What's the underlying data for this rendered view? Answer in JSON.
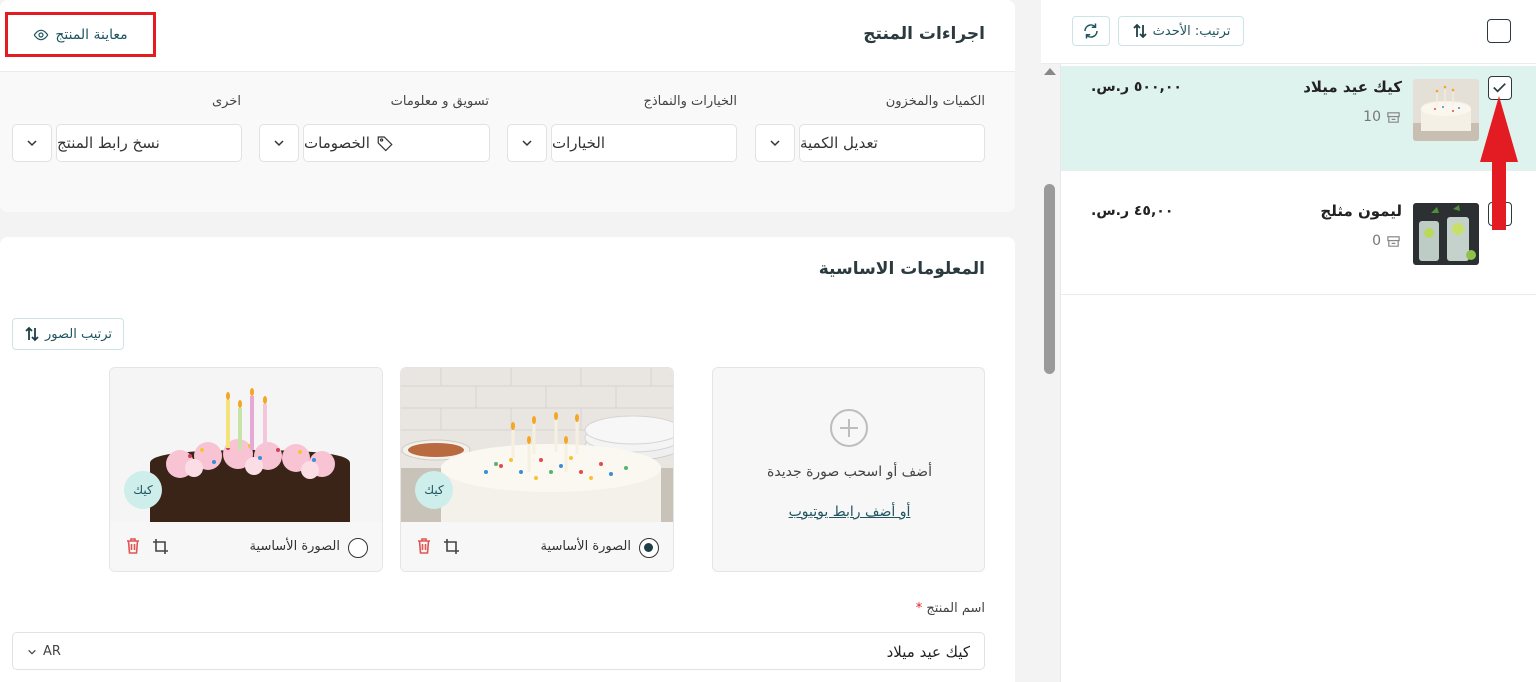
{
  "actions_card": {
    "title": "اجراءات المنتج",
    "preview_button": "معاينة المنتج",
    "groups": [
      {
        "label": "الكميات والمخزون",
        "value": "تعديل الكمية"
      },
      {
        "label": "الخيارات والنماذج",
        "value": "الخيارات"
      },
      {
        "label": "تسويق و معلومات",
        "value": "الخصومات"
      },
      {
        "label": "اخرى",
        "value": "نسخ رابط المنتج"
      }
    ]
  },
  "info_card": {
    "title": "المعلومات الاساسية",
    "sort_images_button": "ترتيب الصور",
    "upload": {
      "text": "أضف أو اسحب صورة جديدة",
      "youtube_link": "أو أضف رابط يوتيوب"
    },
    "images": [
      {
        "main_label": "الصورة الأساسية",
        "selected": true,
        "tag": "كيك",
        "alt": "كيك عيد ميلاد مع شموع وحلويات ملونة"
      },
      {
        "main_label": "الصورة الأساسية",
        "selected": false,
        "tag": "كيك",
        "alt": "كيك بالشوكولاتة والكريمة الوردية"
      }
    ],
    "name_label": "اسم المنتج",
    "required_mark": "*",
    "name_value": "كيك عيد ميلاد",
    "lang": "AR"
  },
  "side_panel": {
    "sort_label": "ترتيب: الأحدث",
    "products": [
      {
        "name": "كيك عيد ميلاد",
        "qty": "10",
        "price": "٥٠٠,٠٠ ر.س.",
        "checked": true,
        "active": true
      },
      {
        "name": "ليمون مثلج",
        "qty": "0",
        "price": "٤٥,٠٠ ر.س.",
        "checked": false,
        "active": false
      }
    ]
  },
  "colors": {
    "accent": "#1f5561",
    "active_row": "#dff3ee",
    "highlight_red": "#e31b23"
  }
}
